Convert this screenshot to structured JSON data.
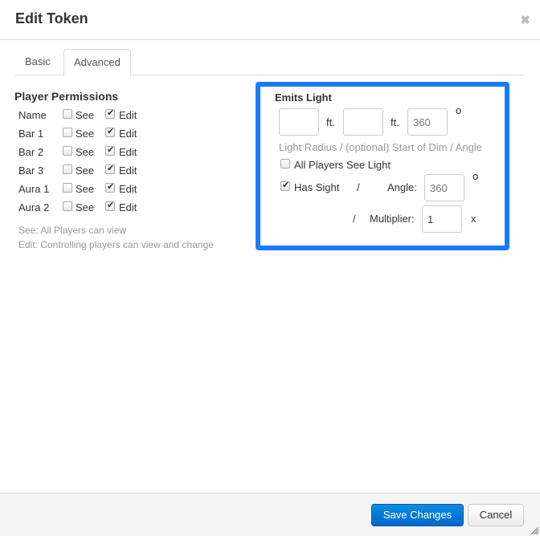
{
  "dialog": {
    "title": "Edit Token",
    "close_icon": "close-icon"
  },
  "tabs": [
    {
      "label": "Basic",
      "active": false
    },
    {
      "label": "Advanced",
      "active": true
    }
  ],
  "permissions": {
    "heading": "Player Permissions",
    "see_label": "See",
    "edit_label": "Edit",
    "rows": [
      {
        "label": "Name",
        "see": false,
        "edit": true
      },
      {
        "label": "Bar 1",
        "see": false,
        "edit": true
      },
      {
        "label": "Bar 2",
        "see": false,
        "edit": true
      },
      {
        "label": "Bar 3",
        "see": false,
        "edit": true
      },
      {
        "label": "Aura 1",
        "see": false,
        "edit": true
      },
      {
        "label": "Aura 2",
        "see": false,
        "edit": true
      }
    ],
    "help_see": "See: All Players can view",
    "help_edit": "Edit: Controlling players can view and change"
  },
  "light": {
    "heading": "Emits Light",
    "radius_value": "",
    "dim_value": "",
    "angle_placeholder": "360",
    "ft_label": "ft.",
    "degree_symbol": "o",
    "caption": "Light Radius / (optional) Start of Dim / Angle",
    "all_players_label": "All Players See Light",
    "all_players_checked": false,
    "has_sight_label": "Has Sight",
    "has_sight_checked": true,
    "slash": "/",
    "sight_angle_label": "Angle:",
    "sight_angle_placeholder": "360",
    "multiplier_label": "Multiplier:",
    "multiplier_value": "1",
    "multiplier_suffix": "x",
    "highlight_color": "#1a7aff"
  },
  "footer": {
    "save_label": "Save Changes",
    "cancel_label": "Cancel"
  }
}
